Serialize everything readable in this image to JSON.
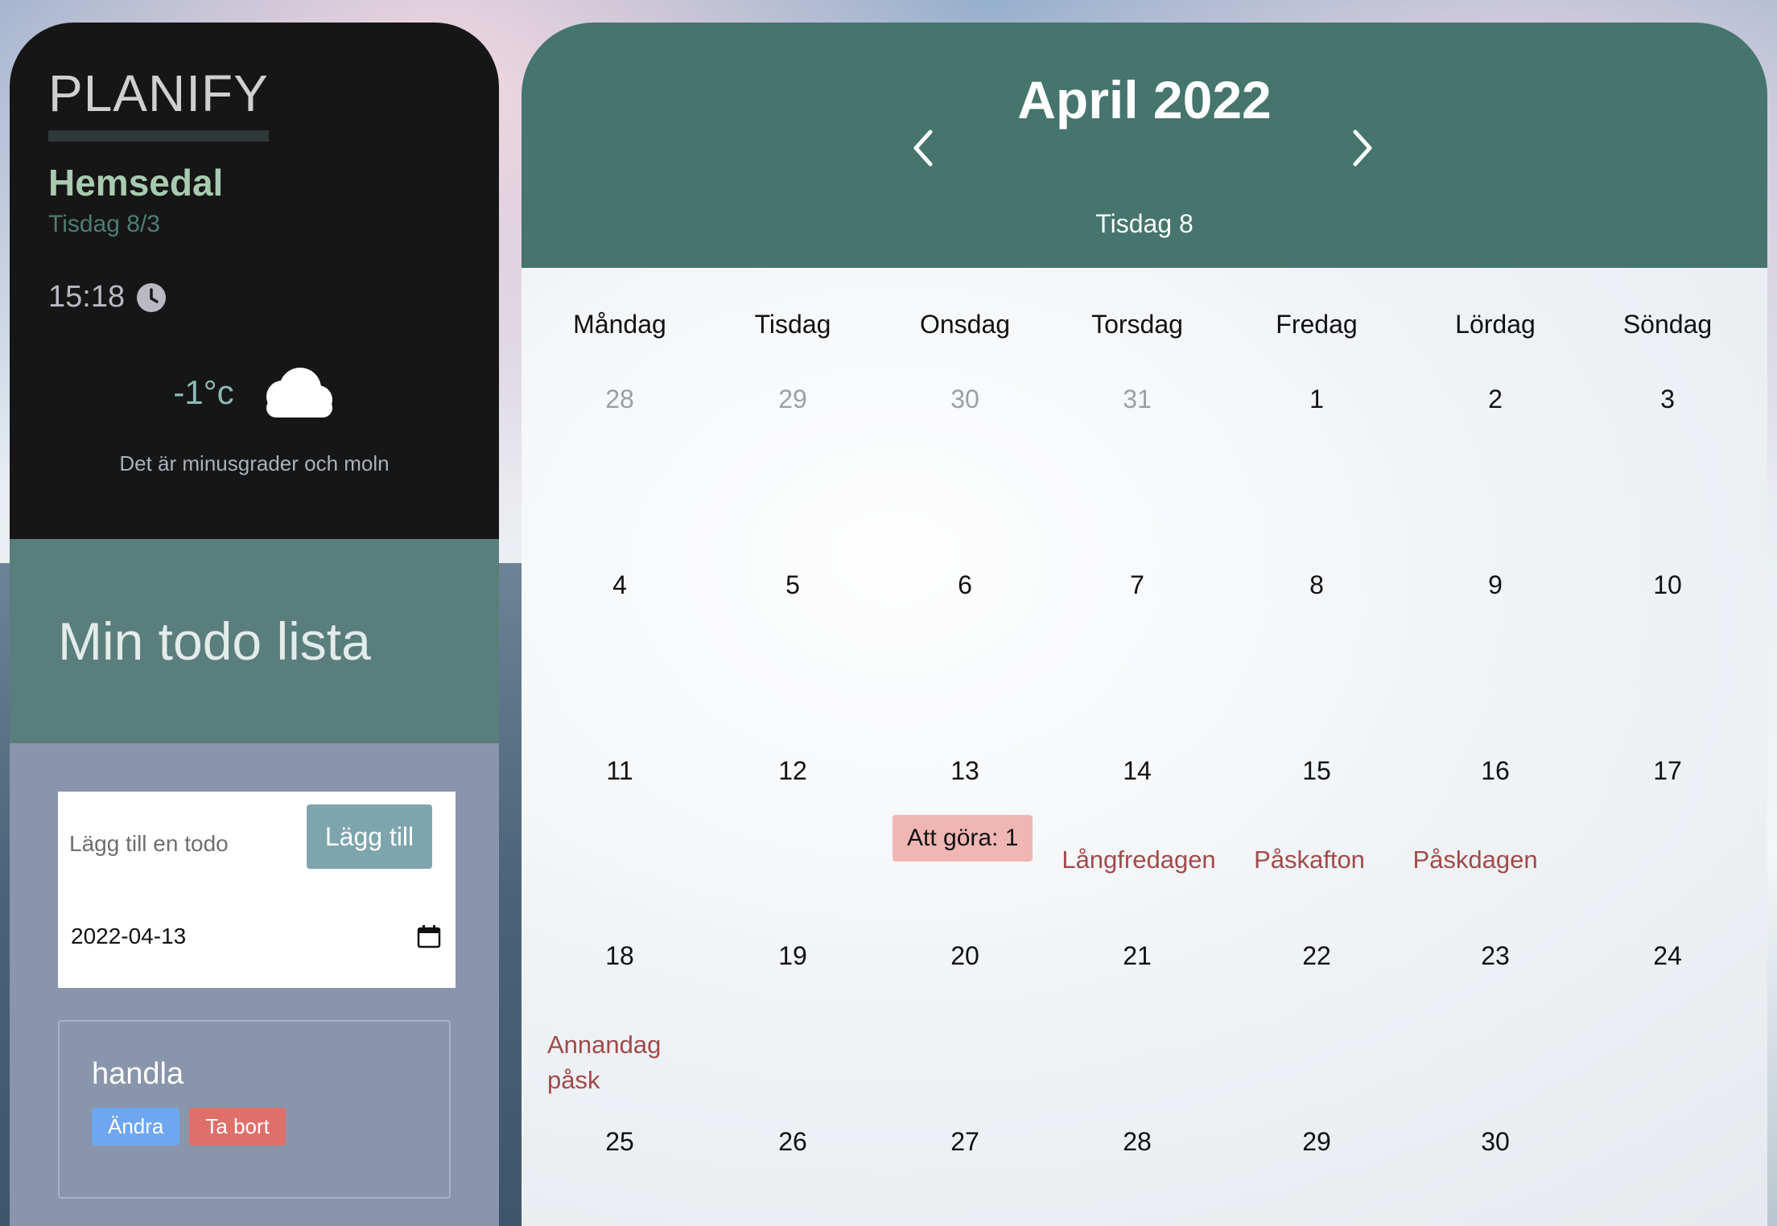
{
  "app": {
    "logo": "PLANIFY"
  },
  "sidebar": {
    "location": "Hemsedal",
    "date": "Tisdag 8/3",
    "time": "15:18",
    "temperature": "-1°c",
    "weather_description": "Det är minusgrader och moln",
    "icons": {
      "clock": "clock-icon",
      "weather": "cloud-icon"
    }
  },
  "todo": {
    "title": "Min todo lista",
    "input_placeholder": "Lägg till en todo",
    "add_label": "Lägg till",
    "date_value": "2022-04-13",
    "items": [
      {
        "text": "handla",
        "edit_label": "Ändra",
        "delete_label": "Ta bort"
      }
    ]
  },
  "calendar": {
    "month_title": "April 2022",
    "today_label": "Tisdag 8",
    "weekdays": [
      "Måndag",
      "Tisdag",
      "Onsdag",
      "Torsdag",
      "Fredag",
      "Lördag",
      "Söndag"
    ],
    "weeks": [
      [
        "28",
        "29",
        "30",
        "31",
        "1",
        "2",
        "3"
      ],
      [
        "4",
        "5",
        "6",
        "7",
        "8",
        "9",
        "10"
      ],
      [
        "11",
        "12",
        "13",
        "14",
        "15",
        "16",
        "17"
      ],
      [
        "18",
        "19",
        "20",
        "21",
        "22",
        "23",
        "24"
      ],
      [
        "25",
        "26",
        "27",
        "28",
        "29",
        "30",
        ""
      ]
    ],
    "muted_days_first_week": 4,
    "todo_badge": "Att göra: 1",
    "holidays": {
      "langfredagen": "Långfredagen",
      "paskafton": "Påskafton",
      "paskdagen": "Påskdagen",
      "annandag_line1": "Annandag",
      "annandag_line2": "påsk"
    },
    "colors": {
      "header": "#45756d",
      "holiday": "#a14a4a",
      "badge": "#f0b6b4"
    }
  }
}
